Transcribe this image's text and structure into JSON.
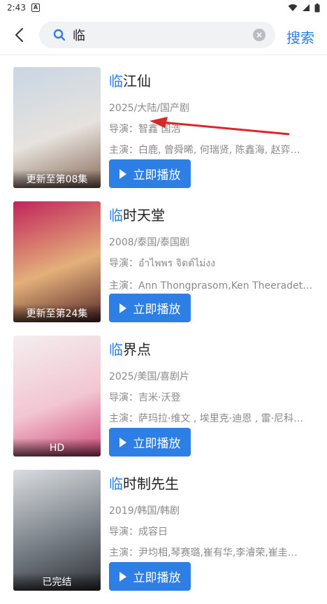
{
  "status": {
    "time": "2:43",
    "badge": "A"
  },
  "search": {
    "value": "临",
    "button_label": "搜索"
  },
  "results": [
    {
      "title_highlight": "临",
      "title_rest": "江仙",
      "meta": "2025/大陆/国产剧",
      "director": "导演：智鑫 国浩",
      "cast": "主演：白鹿, 曾舜晞, 何瑞贤, 陈鑫海, 赵弈…",
      "badge": "更新至第08集",
      "play_label": "立即播放",
      "poster_colors": [
        "#c9d6e3",
        "#e6e2dd",
        "#8a6b5a"
      ]
    },
    {
      "title_highlight": "临",
      "title_rest": "时天堂",
      "meta": "2008/泰国/泰国剧",
      "director": "导演：อำไพพร จิตต์ไม่งง",
      "cast": "主演：Ann Thongprasom,Ken Theeradeth …",
      "badge": "更新至第24集",
      "play_label": "立即播放",
      "poster_colors": [
        "#c2235b",
        "#e3b07a",
        "#5a2a2a"
      ]
    },
    {
      "title_highlight": "临",
      "title_rest": "界点",
      "meta": "2025/美国/喜剧片",
      "director": "导演：吉米·沃登",
      "cast": "主演：萨玛拉·维文 , 埃里克·迪恩 , 雷·尼科…",
      "badge": "HD",
      "play_label": "立即播放",
      "poster_colors": [
        "#f4eef0",
        "#f2c6d2",
        "#d14a7a"
      ]
    },
    {
      "title_highlight": "临",
      "title_rest": "时制先生",
      "meta": "2019/韩国/韩剧",
      "director": "导演：成容日",
      "cast": "主演：尹均相,琴赛璐,崔有华,李濬荣,崔圭…",
      "badge": "已完结",
      "play_label": "立即播放",
      "poster_colors": [
        "#d9dde0",
        "#7a8088",
        "#2e3238"
      ]
    }
  ]
}
